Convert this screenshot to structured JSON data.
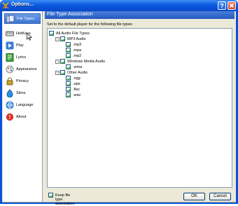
{
  "window": {
    "title": "Options..."
  },
  "titlebar_buttons": {
    "help_icon": "help-icon",
    "close_icon": "close-icon"
  },
  "sidebar": {
    "items": [
      {
        "label": "File Types",
        "icon": "file-types-icon",
        "selected": true
      },
      {
        "label": "HotKeys",
        "icon": "keyboard-icon",
        "selected": false
      },
      {
        "label": "Play",
        "icon": "play-icon",
        "selected": false
      },
      {
        "label": "Lyrics",
        "icon": "lyrics-icon",
        "selected": false
      },
      {
        "label": "Appearance",
        "icon": "appearance-icon",
        "selected": false
      },
      {
        "label": "Privacy",
        "icon": "lock-icon",
        "selected": false
      },
      {
        "label": "Skins",
        "icon": "skins-icon",
        "selected": false
      },
      {
        "label": "Language",
        "icon": "language-icon",
        "selected": false
      },
      {
        "label": "About",
        "icon": "info-icon",
        "selected": false
      }
    ]
  },
  "panel": {
    "title": "File Type Association",
    "description": "Set to the default player for the following file types:"
  },
  "tree": [
    {
      "label": "All Audio File Types",
      "checked": true,
      "toggle": "-",
      "level": 0
    },
    {
      "label": "MP3 Audio",
      "checked": true,
      "toggle": "-",
      "level": 1
    },
    {
      "label": ".mp3",
      "checked": true,
      "toggle": "",
      "level": 2
    },
    {
      "label": ".mpa",
      "checked": true,
      "toggle": "",
      "level": 2
    },
    {
      "label": ".mp2",
      "checked": true,
      "toggle": "",
      "level": 2
    },
    {
      "label": "Windows Media Audio",
      "checked": true,
      "toggle": "-",
      "level": 1
    },
    {
      "label": ".wma",
      "checked": true,
      "toggle": "",
      "level": 2
    },
    {
      "label": "Other Audio",
      "checked": true,
      "toggle": "-",
      "level": 1
    },
    {
      "label": ".ogg",
      "checked": true,
      "toggle": "",
      "level": 2
    },
    {
      "label": ".ape",
      "checked": true,
      "toggle": "",
      "level": 2
    },
    {
      "label": ".flac",
      "checked": true,
      "toggle": "",
      "level": 2
    },
    {
      "label": ".wav",
      "checked": true,
      "toggle": "",
      "level": 2
    }
  ],
  "keep_association": {
    "label": "Keep file type association",
    "checked": true
  },
  "buttons": {
    "ok": "OK",
    "cancel": "Cancel"
  },
  "colors": {
    "titlebar": "#0a5ae0",
    "selection": "#3d74d4",
    "checkmark": "#21a121",
    "dialog_bg": "#ece9d8"
  }
}
